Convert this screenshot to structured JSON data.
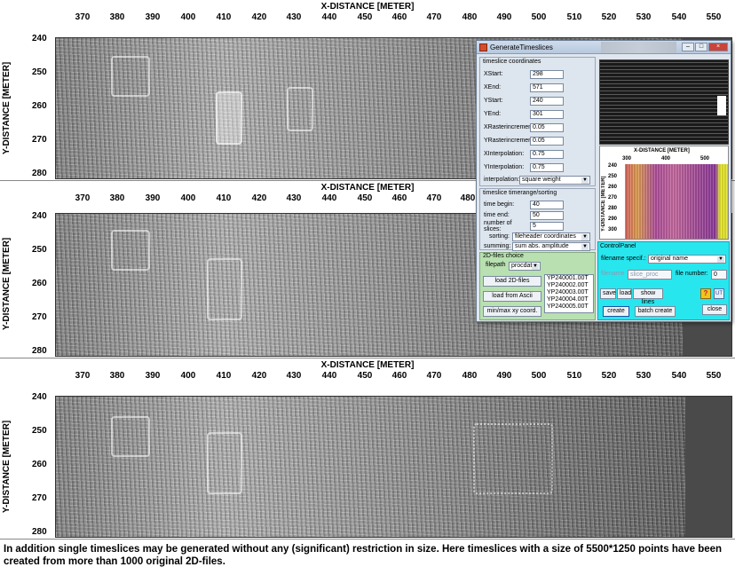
{
  "plots": [
    {
      "title": "X-DISTANCE [METER]",
      "ylabel": "Y-DISTANCE [METER]",
      "xticks": [
        "370",
        "380",
        "390",
        "400",
        "410",
        "420",
        "430",
        "440",
        "450",
        "460",
        "470",
        "480",
        "490",
        "500",
        "510",
        "520",
        "530",
        "540",
        "550"
      ],
      "yticks": [
        "240",
        "250",
        "260",
        "270",
        "280"
      ]
    },
    {
      "title": "X-DISTANCE [METER]",
      "ylabel": "Y-DISTANCE [METER]",
      "xticks": [
        "370",
        "380",
        "390",
        "400",
        "410",
        "420",
        "430",
        "440",
        "450",
        "460",
        "470",
        "480"
      ],
      "yticks": [
        "240",
        "250",
        "260",
        "270",
        "280"
      ]
    },
    {
      "title": "X-DISTANCE [METER]",
      "ylabel": "Y-DISTANCE [METER]",
      "xticks": [
        "370",
        "380",
        "390",
        "400",
        "410",
        "420",
        "430",
        "440",
        "450",
        "460",
        "470",
        "480",
        "490",
        "500",
        "510",
        "520",
        "530",
        "540",
        "550"
      ],
      "yticks": [
        "240",
        "250",
        "260",
        "270",
        "280"
      ]
    }
  ],
  "dialog": {
    "title": "GenerateTimeslices",
    "coords_group": "timeslice coordinates",
    "fields": [
      {
        "label": "XStart:",
        "value": "298"
      },
      {
        "label": "XEnd:",
        "value": "571"
      },
      {
        "label": "YStart:",
        "value": "240"
      },
      {
        "label": "YEnd:",
        "value": "301"
      },
      {
        "label": "XRasterincrement:",
        "value": "0.05"
      },
      {
        "label": "YRasterincrement:",
        "value": "0.05"
      },
      {
        "label": "XInterpolation:",
        "value": "0.75"
      },
      {
        "label": "YInterpolation:",
        "value": "0.75"
      }
    ],
    "interpolation_label": "interpolation:",
    "interpolation_value": "square weight",
    "timerange_group": "timeslice timerange/sorting",
    "time_fields": [
      {
        "label": "time begin:",
        "value": "40"
      },
      {
        "label": "time end:",
        "value": "50"
      },
      {
        "label": "number of slices:",
        "value": "5"
      }
    ],
    "sorting_label": "sorting:",
    "sorting_value": "fileheader coordinates",
    "summing_label": "summing:",
    "summing_value": "sum abs. amplitude",
    "files_group": "2D-files choice",
    "filepath_label": "filepath",
    "filepath_value": "procdata",
    "load_2d_label": "load 2D-files",
    "load_ascii_label": "load from Ascii",
    "minmax_label": "min/max xy coord.",
    "file_list": [
      "YP240001.00T",
      "YP240002.00T",
      "YP240003.00T",
      "YP240004.00T",
      "YP240005.00T"
    ],
    "preview": {
      "title": "X-DISTANCE [METER]",
      "xticks": [
        "300",
        "400",
        "500"
      ],
      "ylabel": "Y-DISTANCE [METER]",
      "yticks": [
        "240",
        "250",
        "260",
        "270",
        "280",
        "290",
        "300"
      ]
    },
    "control_panel": {
      "title": "ControlPanel",
      "filename_spec_label": "filename specif.:",
      "filename_spec_value": "original name",
      "filename_label": "filename",
      "filename_value": "slice_proc",
      "file_number_label": "file number:",
      "file_number_value": "0",
      "save_label": "save",
      "load_label": "load",
      "show_lines_label": "show lines",
      "create_label": "create",
      "batch_create_label": "batch create",
      "close_label": "close",
      "help_glyph": "?",
      "grid_glyph": "UT"
    },
    "win_min": "–",
    "win_max": "□",
    "win_close": "×"
  },
  "caption": "In addition single timeslices may be generated without any (significant) restriction in size. Here timeslices with a size of 5500*1250 points have been created from more than 1000 original 2D-files.",
  "icons": {
    "app": "app-icon",
    "help": "help-icon",
    "grid": "grid-icon"
  }
}
